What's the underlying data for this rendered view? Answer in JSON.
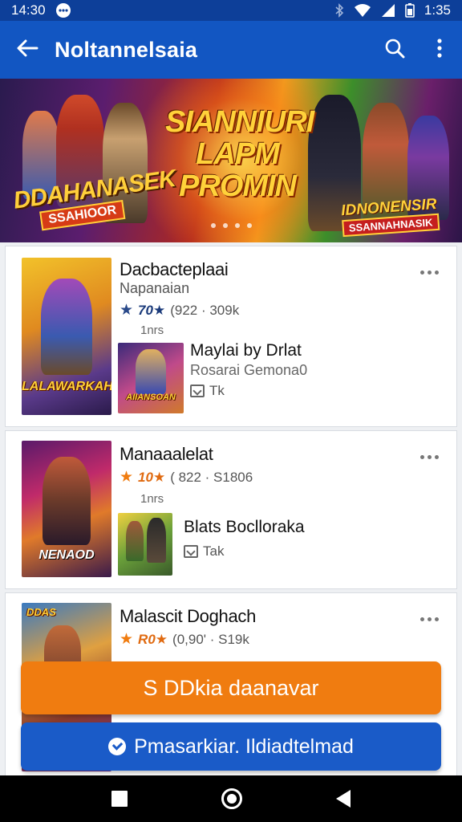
{
  "status_bar": {
    "time_left": "14:30",
    "time_right": "1:35",
    "icons": [
      "chat-bubble-icon",
      "bluetooth-icon",
      "wifi-icon",
      "signal-icon",
      "battery-icon"
    ]
  },
  "app_bar": {
    "title": "Noltannelsaia",
    "back_icon": "arrow-left-icon",
    "search_icon": "search-icon",
    "menu_icon": "more-vertical-icon"
  },
  "banner": {
    "headline": "SIANNIURI LAPM PROMIN",
    "badge_left_line1": "DDAHANASEK",
    "badge_left_line2": "SSAHIOOR",
    "badge_right_line1": "IDNONENSIR",
    "badge_right_line2": "SSANNAHNASIK",
    "page_count": 4
  },
  "list": [
    {
      "name": "Dacbacteplaai",
      "developer": "Napanaian",
      "rating": "70★",
      "reviews": "(922 · 309k",
      "size": "1nrs",
      "cover_text": "LALAWARKAH",
      "related": {
        "name": "Maylai by Drlat",
        "developer": "Rosarai Gemona0",
        "size": "Tk",
        "cover_text": "AIIANSOAN"
      }
    },
    {
      "name": "Manaaalelat",
      "developer": "",
      "rating": "10★",
      "reviews": "( 822 · S1806",
      "size": "1nrs",
      "cover_text": "NENAOD",
      "related": {
        "name": "Blats Boclloraka",
        "developer": "",
        "size": "Tak",
        "cover_text": ""
      }
    },
    {
      "name": "Malascit Doghach",
      "developer": "",
      "rating": "R0★",
      "reviews": "(0,90' · S19k",
      "size": "",
      "cover_text": "DDAS",
      "related": null
    }
  ],
  "actions": {
    "primary_label": "S DDkia daanavar",
    "secondary_label": "Pmasarkiar. Ildiadtelmad"
  },
  "colors": {
    "app_bar": "#1256c2",
    "status_bar": "#0d3f99",
    "primary_button": "#f07c10",
    "secondary_button": "#1a5bc8",
    "star": "#f07c10"
  }
}
